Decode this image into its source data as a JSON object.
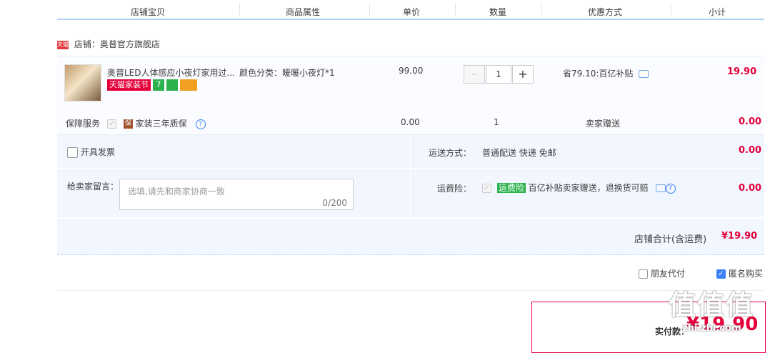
{
  "header": {
    "columns": [
      "店铺宝贝",
      "商品属性",
      "单价",
      "数量",
      "优惠方式",
      "小计"
    ]
  },
  "shop": {
    "logo": "天猫",
    "label": "店铺：奥普官方旗舰店"
  },
  "item": {
    "title": "奥普LED人体感应小夜灯家用过...",
    "tags": [
      "天猫家装节",
      "7",
      "",
      "",
      ""
    ],
    "attr": "颜色分类：暖暖小夜灯*1",
    "price": "99.00",
    "qty": "1",
    "minus": "−",
    "plus": "+",
    "discount": "省79.10:百亿补贴",
    "subtotal": "19.90"
  },
  "service": {
    "label": "保障服务",
    "badge": "保",
    "name": "家装三年质保",
    "help": "?",
    "price": "0.00",
    "qty": "1",
    "method": "卖家赠送",
    "subtotal": "0.00"
  },
  "invoice": {
    "label": "开具发票"
  },
  "shipping": {
    "label": "运送方式：",
    "value": "普通配送 快递 免邮",
    "cost": "0.00"
  },
  "message": {
    "label": "给卖家留言：",
    "placeholder": "选填,请先和商家协商一致",
    "counter": "0/200"
  },
  "insurance": {
    "label": "运费险：",
    "badge": "运费险",
    "desc": "百亿补贴卖家赠送，退换货可赔",
    "help": "?",
    "cost": "0.00"
  },
  "total": {
    "label": "店铺合计(含运费)",
    "value": "¥19.90"
  },
  "options": {
    "friend_pay": "朋友代付",
    "anonymous": "匿名购买",
    "check": "✓"
  },
  "pay": {
    "label": "实付款：",
    "amount": "¥19.90"
  },
  "watermark": {
    "text": "值值值",
    "url": "zhi.zhi.com"
  }
}
